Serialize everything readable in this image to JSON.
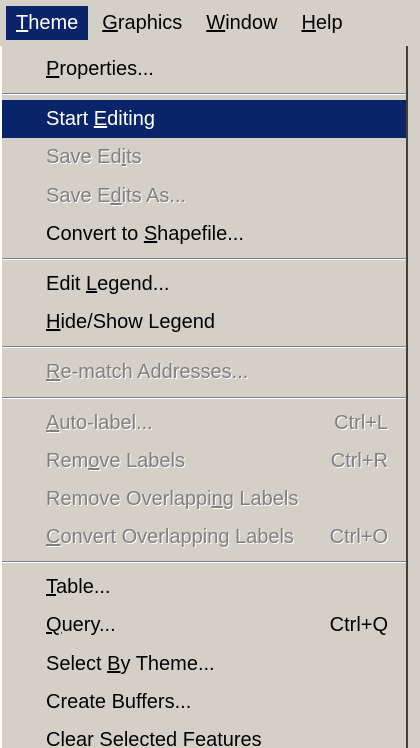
{
  "menubar": {
    "items": [
      {
        "pre": "",
        "key": "T",
        "post": "heme"
      },
      {
        "pre": "",
        "key": "G",
        "post": "raphics"
      },
      {
        "pre": "",
        "key": "W",
        "post": "indow"
      },
      {
        "pre": "",
        "key": "H",
        "post": "elp"
      }
    ]
  },
  "menu": {
    "items": [
      {
        "pre": "",
        "key": "P",
        "post": "roperties...",
        "shortcut": ""
      },
      {
        "pre": "Start ",
        "key": "E",
        "post": "diting",
        "shortcut": ""
      },
      {
        "pre": "Save Ed",
        "key": "i",
        "post": "ts",
        "shortcut": ""
      },
      {
        "pre": "Save E",
        "key": "d",
        "post": "its As...",
        "shortcut": ""
      },
      {
        "pre": "Convert to ",
        "key": "S",
        "post": "hapefile...",
        "shortcut": ""
      },
      {
        "pre": "Edit ",
        "key": "L",
        "post": "egend...",
        "shortcut": ""
      },
      {
        "pre": "",
        "key": "H",
        "post": "ide/Show Legend",
        "shortcut": ""
      },
      {
        "pre": "",
        "key": "R",
        "post": "e-match Addresses...",
        "shortcut": ""
      },
      {
        "pre": "",
        "key": "A",
        "post": "uto-label...",
        "shortcut": "Ctrl+L"
      },
      {
        "pre": "Rem",
        "key": "o",
        "post": "ve Labels",
        "shortcut": "Ctrl+R"
      },
      {
        "pre": "Remove Overlappi",
        "key": "n",
        "post": "g Labels",
        "shortcut": ""
      },
      {
        "pre": "",
        "key": "C",
        "post": "onvert Overlapping Labels",
        "shortcut": "Ctrl+O"
      },
      {
        "pre": "",
        "key": "T",
        "post": "able...",
        "shortcut": ""
      },
      {
        "pre": "",
        "key": "Q",
        "post": "uery...",
        "shortcut": "Ctrl+Q"
      },
      {
        "pre": "Select ",
        "key": "B",
        "post": "y Theme...",
        "shortcut": ""
      },
      {
        "pre": "Create Buffers...",
        "key": "",
        "post": "",
        "shortcut": ""
      },
      {
        "pre": "Clear Selected Features",
        "key": "",
        "post": "",
        "shortcut": ""
      }
    ]
  }
}
